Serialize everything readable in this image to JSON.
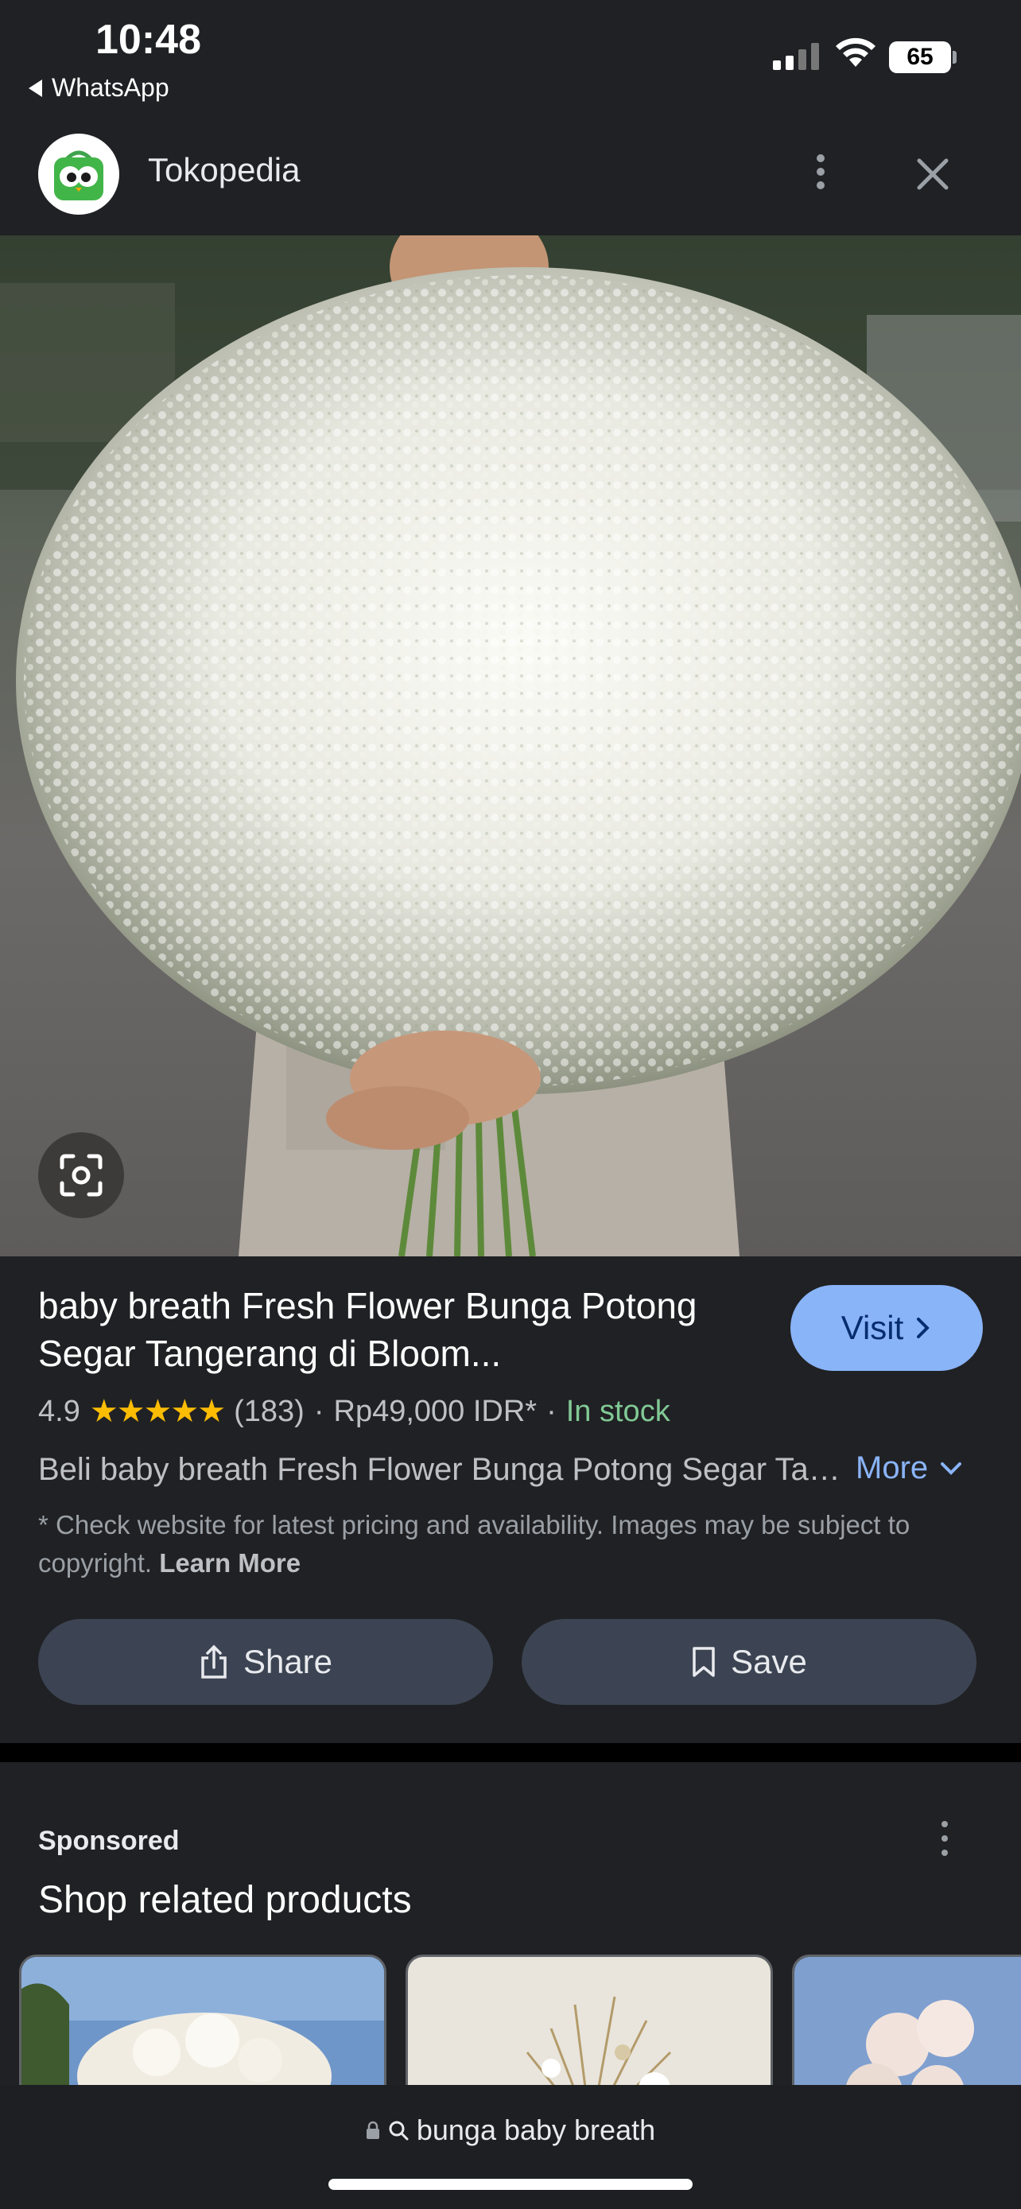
{
  "status_bar": {
    "time": "10:48",
    "back_app": "WhatsApp",
    "battery": "65"
  },
  "header": {
    "site_name": "Tokopedia"
  },
  "product": {
    "title": "baby breath Fresh Flower Bunga Potong Segar Tangerang di Bloom...",
    "visit_label": "Visit",
    "rating": "4.9",
    "stars": "★★★★★",
    "review_count": "(183)",
    "separator": "·",
    "price": "Rp49,000 IDR*",
    "availability": "In stock",
    "description": "Beli baby breath Fresh Flower Bunga Potong Segar Tangerang di Bloom",
    "more_label": "More",
    "disclaimer": "* Check website for latest pricing and availability. Images may be subject to copyright.",
    "learn_more": "Learn More"
  },
  "actions": {
    "share_label": "Share",
    "save_label": "Save"
  },
  "related": {
    "sponsored_label": "Sponsored",
    "section_title": "Shop related products"
  },
  "url_bar": {
    "query": "bunga baby breath"
  },
  "colors": {
    "accent": "#8ab4f8",
    "in_stock": "#81c995",
    "star": "#fbbc04",
    "background": "#202124",
    "button": "#3c4453"
  },
  "icons": [
    "back-arrow-icon",
    "signal-icon",
    "wifi-icon",
    "battery-icon",
    "tokopedia-logo",
    "more-vert-icon",
    "close-icon",
    "lens-icon",
    "chevron-right-icon",
    "chevron-down-icon",
    "share-icon",
    "bookmark-icon",
    "lock-icon",
    "search-icon"
  ]
}
